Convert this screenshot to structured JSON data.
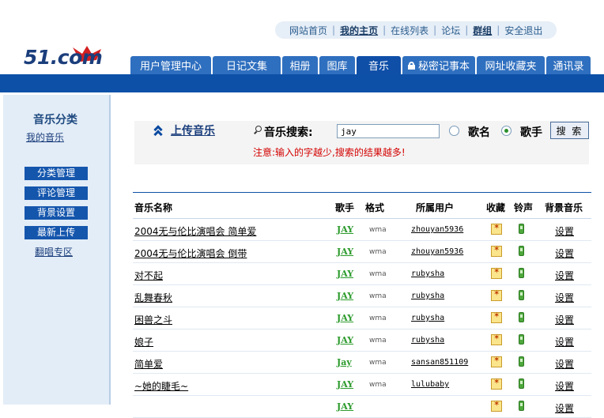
{
  "topnav": {
    "items": [
      "网站首页",
      "我的主页",
      "在线列表",
      "论坛",
      "群组",
      "安全退出"
    ],
    "separator": "|"
  },
  "logo": {
    "text": "51.com"
  },
  "tabs": [
    {
      "label": "用户管理中心",
      "active": false
    },
    {
      "label": "日记文集",
      "active": false
    },
    {
      "label": "相册",
      "active": false
    },
    {
      "label": "图库",
      "active": false
    },
    {
      "label": "音乐",
      "active": true
    },
    {
      "label": "秘密记事本",
      "active": false,
      "icon": "lock-icon"
    },
    {
      "label": "网址收藏夹",
      "active": false
    },
    {
      "label": "通讯录",
      "active": false
    }
  ],
  "sidebar": {
    "title": "音乐分类",
    "my_music": "我的音乐",
    "buttons": [
      "分类管理",
      "评论管理",
      "背景设置",
      "最新上传"
    ],
    "cover_link": "翻唱专区"
  },
  "search": {
    "upload_label": "上传音乐",
    "label": "音乐搜索:",
    "value": "jay",
    "option_song": "歌名",
    "option_singer": "歌手",
    "selected": "歌手",
    "button": "搜 索",
    "notice": "注意:输入的字越少,搜索的结果越多!"
  },
  "table": {
    "headers": {
      "name": "音乐名称",
      "singer": "歌手",
      "format": "格式",
      "user": "所属用户",
      "fav": "收藏",
      "ring": "铃声",
      "bgm": "背景音乐"
    },
    "rows": [
      {
        "name": "2004无与伦比演唱会 简单爱",
        "singer": "JAY",
        "format": "wma",
        "user": "zhouyan5936",
        "bgm": "设置"
      },
      {
        "name": "2004无与伦比演唱会 倒带",
        "singer": "JAY",
        "format": "wma",
        "user": "zhouyan5936",
        "bgm": "设置"
      },
      {
        "name": "对不起",
        "singer": "JAY",
        "format": "wma",
        "user": "rubysha",
        "bgm": "设置"
      },
      {
        "name": "乱舞春秋",
        "singer": "JAY",
        "format": "wma",
        "user": "rubysha",
        "bgm": "设置"
      },
      {
        "name": "困兽之斗",
        "singer": "JAY",
        "format": "wma",
        "user": "rubysha",
        "bgm": "设置"
      },
      {
        "name": "娘子",
        "singer": "JAY",
        "format": "wma",
        "user": "rubysha",
        "bgm": "设置"
      },
      {
        "name": "简单爱",
        "singer": "Jay",
        "format": "wma",
        "user": "sansan851109",
        "bgm": "设置"
      },
      {
        "name": "~她的睫毛~",
        "singer": "JAY",
        "format": "wma",
        "user": "lulubaby",
        "bgm": "设置"
      },
      {
        "name": "",
        "singer": "JAY",
        "format": "",
        "user": "",
        "bgm": "设置"
      }
    ]
  },
  "colors": {
    "brand_blue": "#0c50a8",
    "tab_blue": "#2f6fbf",
    "singer_green": "#2b9a2b",
    "notice_red": "#d40000",
    "sidebar_bg": "#e3edf7"
  }
}
